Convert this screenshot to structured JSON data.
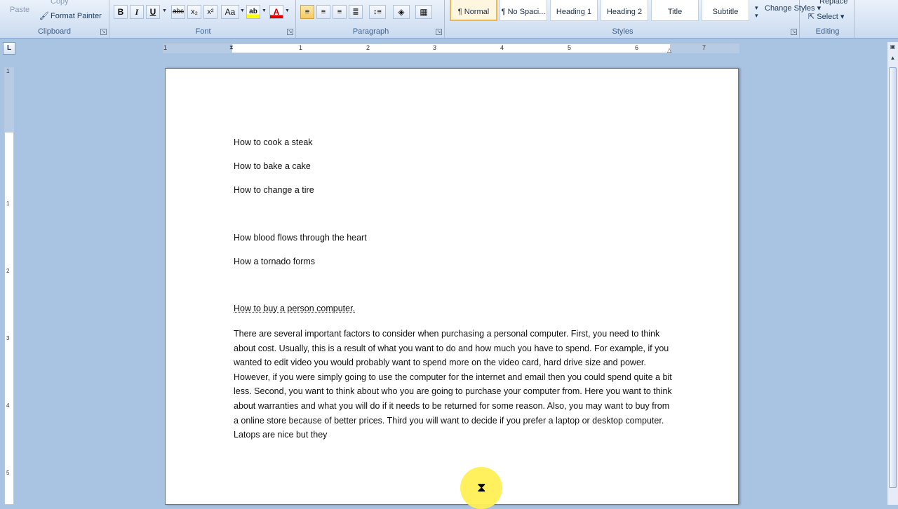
{
  "ribbon": {
    "clipboard": {
      "label": "Clipboard",
      "paste": "Paste",
      "copy": "Copy",
      "format_painter": "Format Painter"
    },
    "font": {
      "label": "Font",
      "bold": "B",
      "italic": "I",
      "underline": "U",
      "strike": "abc",
      "subscript": "x₂",
      "superscript": "x²",
      "change_case": "Aa",
      "highlight": "ab",
      "font_color": "A"
    },
    "paragraph": {
      "label": "Paragraph"
    },
    "styles": {
      "label": "Styles",
      "items": [
        "¶ Normal",
        "¶ No Spaci...",
        "Heading 1",
        "Heading 2",
        "Title",
        "Subtitle"
      ],
      "change_styles": "Change Styles"
    },
    "editing": {
      "label": "Editing",
      "replace": "Replace",
      "select": "Select"
    }
  },
  "ruler": {
    "h_numbers": [
      "1",
      "1",
      "2",
      "3",
      "4",
      "5",
      "6",
      "7"
    ],
    "v_numbers": [
      "1",
      "1",
      "2",
      "3",
      "4",
      "5"
    ]
  },
  "document": {
    "lines": [
      "How to cook a steak",
      "How to bake a cake",
      "How to change a tire",
      "How blood flows through the heart",
      "How a tornado forms",
      "How to buy a person computer."
    ],
    "paragraph": "There are several important factors to consider when purchasing a personal computer.  First, you need to think about cost.  Usually, this is a result of what you want to do and how much you have to spend.  For example, if you wanted to edit video you would probably want to spend more on the video card, hard drive size and power.  However, if you were simply going to use the computer for the internet and email then you could  spend quite a bit less.   Second, you want to think about who you are going to purchase your computer from.   Here you want to think about warranties and what you will do if  it needs to be returned for some reason.  Also, you may want to buy from a online store because of better prices.  Third you will want to decide if you prefer a laptop or desktop computer.  Latops are nice but they"
  }
}
